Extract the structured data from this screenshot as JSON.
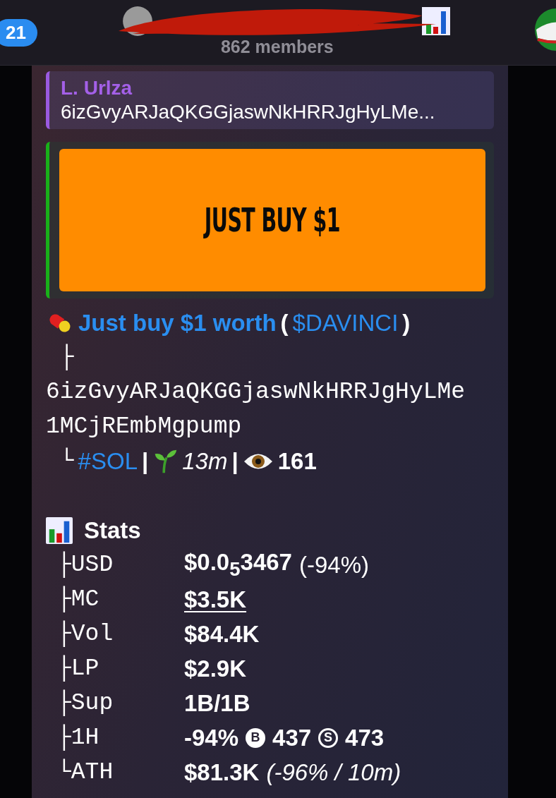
{
  "header": {
    "unread_count": "21",
    "title_redacted": true,
    "subtitle": "862 members"
  },
  "message": {
    "quote": {
      "author": "L. Urlza",
      "text": "6izGvyARJaQKGGjaswNkHRRJgHyLMe..."
    },
    "banner": {
      "text": "JUST BUY $1"
    },
    "token": {
      "name": "Just buy $1 worth",
      "open": "(",
      "ticker": "$DAVINCI",
      "close": ")"
    },
    "branch": "├",
    "address_lines": [
      "6izGvyARJaQKGGjaswNkHRRJgHyLMe",
      "1MCjREmbMgpump"
    ],
    "meta": {
      "corner": "└",
      "chain": "#SOL",
      "sep_1": "|",
      "age": "13m",
      "sep_2": "|",
      "views": "161"
    },
    "stats": {
      "title": "Stats",
      "rows": [
        {
          "branch": "├",
          "label": "USD",
          "kind": "price",
          "value": "$0.0$_{5}$3467",
          "note": "(-94%)"
        },
        {
          "branch": "├",
          "label": "MC",
          "kind": "link",
          "value": "$3.5K"
        },
        {
          "branch": "├",
          "label": "Vol",
          "kind": "plain",
          "value": "$84.4K"
        },
        {
          "branch": "├",
          "label": "LP",
          "kind": "plain",
          "value": "$2.9K"
        },
        {
          "branch": "├",
          "label": "Sup",
          "kind": "plain",
          "value": "1B/1B"
        },
        {
          "branch": "├",
          "label": "1H",
          "kind": "trades",
          "value": "-94%",
          "buy_badge": "B",
          "buys": "437",
          "sell_badge": "S",
          "sells": "473"
        },
        {
          "branch": "└",
          "label": "ATH",
          "kind": "ath",
          "value": "$81.3K",
          "note": "(-96% / 10m)"
        }
      ]
    }
  }
}
